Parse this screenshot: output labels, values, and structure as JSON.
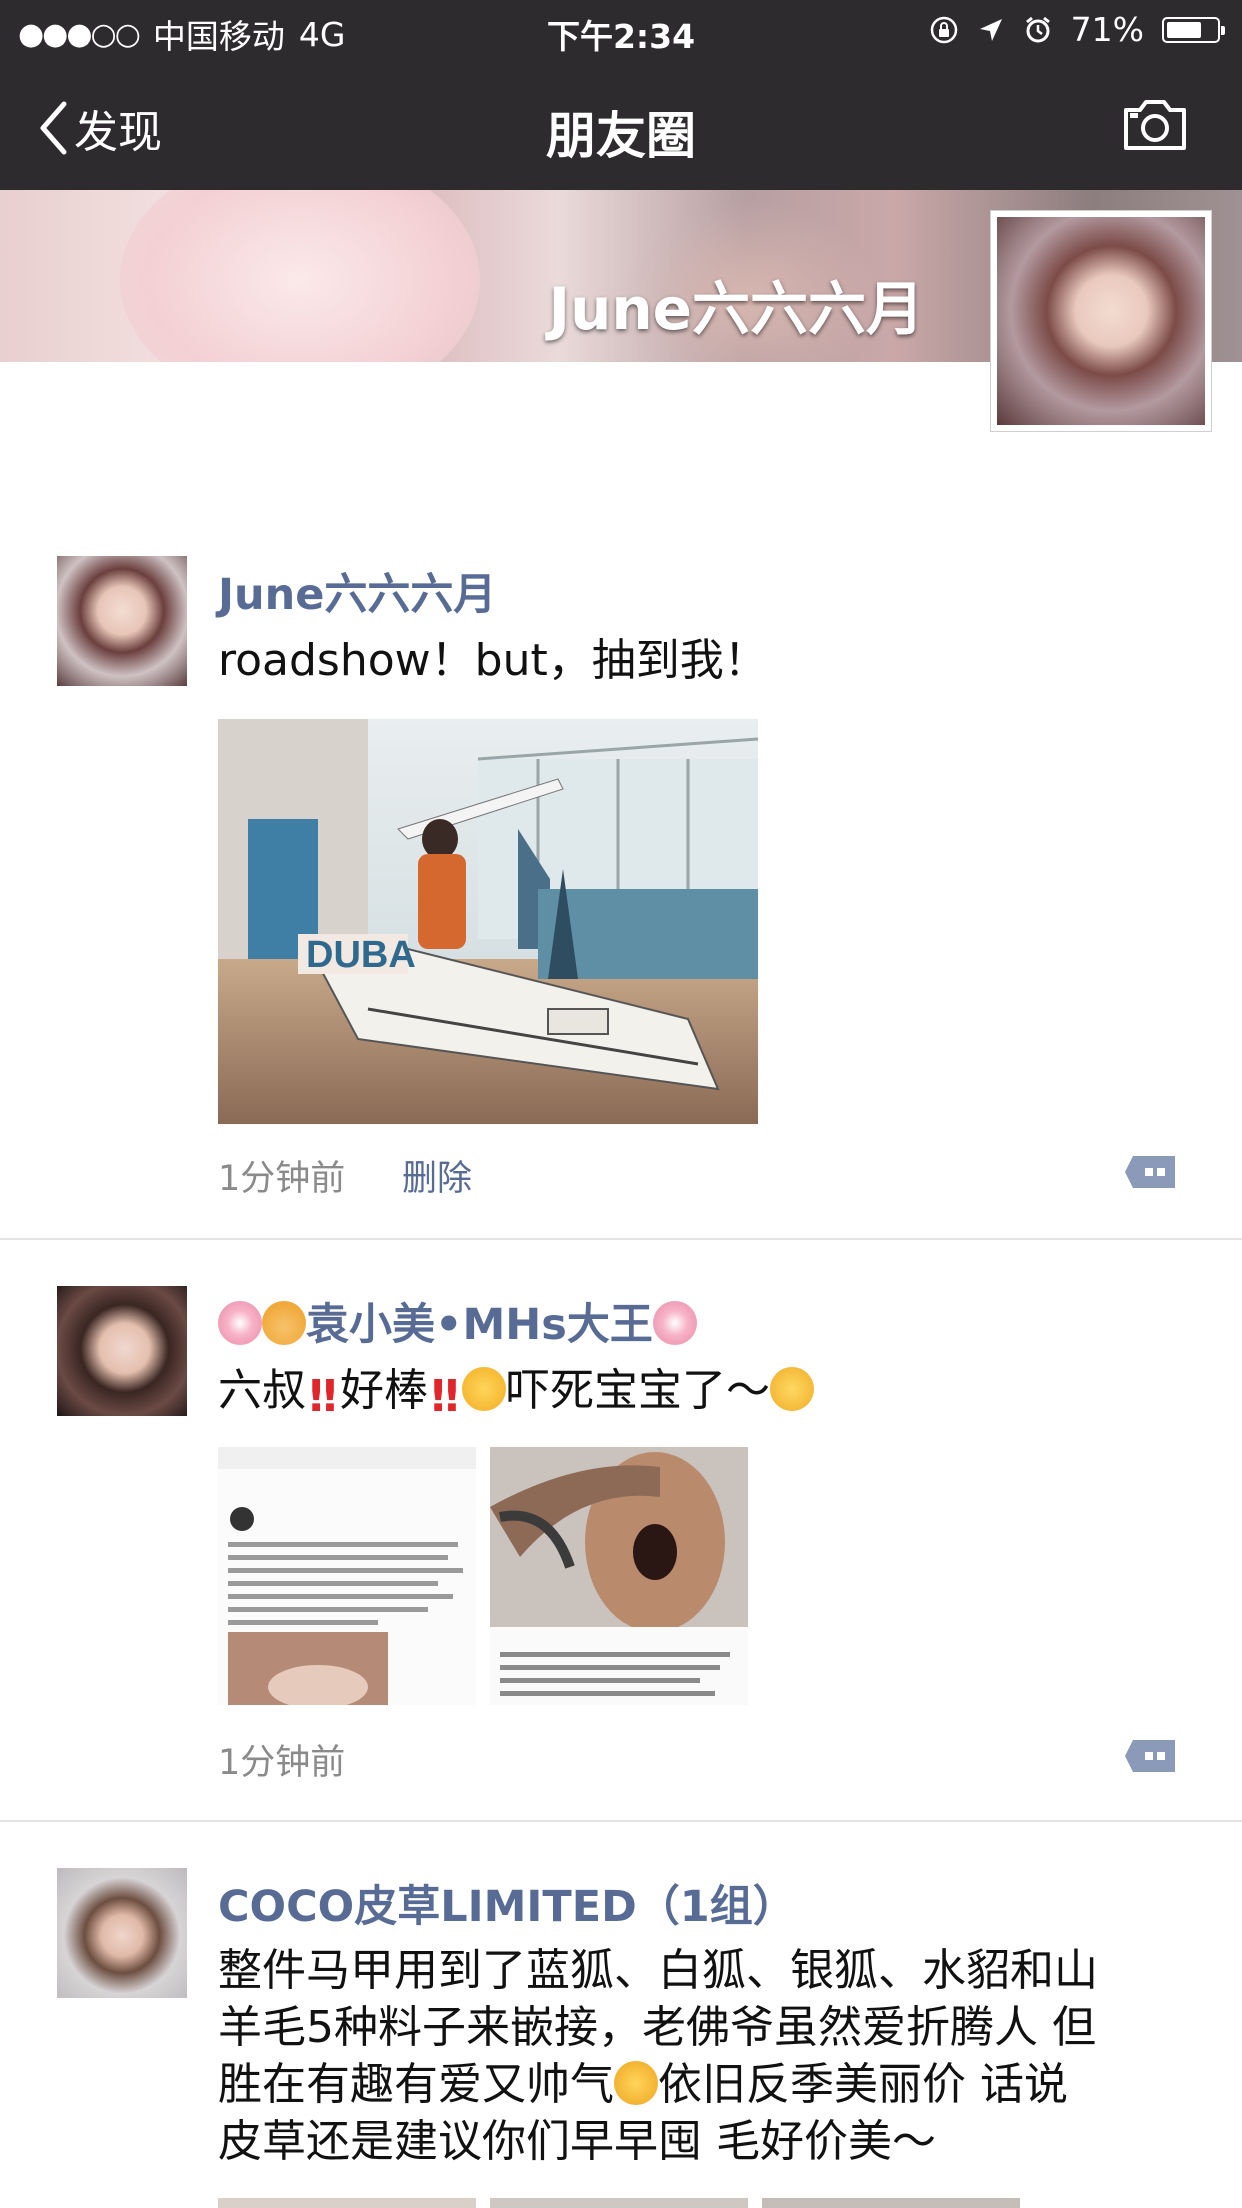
{
  "status_bar": {
    "signal": "●●●○○",
    "carrier": "中国移动",
    "network": "4G",
    "time": "下午2:34",
    "battery_percent": "71%",
    "battery_level": 0.71
  },
  "nav": {
    "back_label": "发现",
    "title": "朋友圈"
  },
  "cover": {
    "username": "June六六六月"
  },
  "posts": [
    {
      "author": "June六六六月",
      "text": "roadshow！but，抽到我！",
      "time": "1分钟前",
      "delete_label": "删除"
    },
    {
      "author_prefix": "",
      "author": "袁小美•MHs大王",
      "text_parts": [
        "六叔",
        "好棒",
        "吓死宝宝了～"
      ],
      "time": "1分钟前"
    },
    {
      "author": "COCO皮草LIMITED（1组）",
      "text_lines": [
        "整件马甲用到了蓝狐、白狐、银狐、水貂和山",
        "羊毛5种料子来嵌接，老佛爷虽然爱折腾人 但",
        "胜在有趣有爱又帅气",
        "依旧反季美丽价 话说",
        "皮草还是建议你们早早囤 毛好价美～"
      ]
    }
  ],
  "colors": {
    "bar_bg": "#2e2b2e",
    "link": "#576b95",
    "divider": "#e3e3e3"
  },
  "icons": {
    "back": "chevron-left-icon",
    "camera": "camera-icon",
    "comment": "comment-menu-icon"
  }
}
